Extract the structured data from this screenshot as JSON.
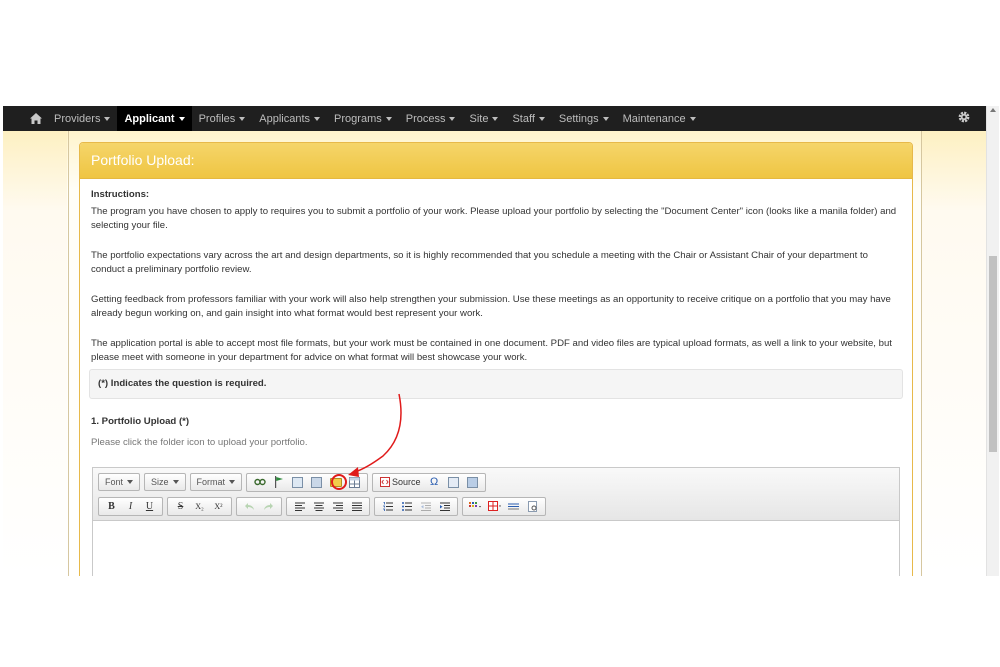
{
  "nav": {
    "items": [
      {
        "label": "Providers",
        "active": false
      },
      {
        "label": "Applicant",
        "active": true
      },
      {
        "label": "Profiles",
        "active": false
      },
      {
        "label": "Applicants",
        "active": false
      },
      {
        "label": "Programs",
        "active": false
      },
      {
        "label": "Process",
        "active": false
      },
      {
        "label": "Site",
        "active": false
      },
      {
        "label": "Staff",
        "active": false
      },
      {
        "label": "Settings",
        "active": false
      },
      {
        "label": "Maintenance",
        "active": false
      }
    ],
    "home_icon": "home-icon",
    "settings_icon": "gear-icon"
  },
  "panel": {
    "title": "Portfolio Upload:",
    "instructions_title": "Instructions:",
    "paragraphs": [
      "The program you have chosen to apply to requires you to submit a portfolio of your work. Please upload your portfolio by selecting the \"Document Center\" icon (looks like a manila folder) and selecting your file.",
      "The portfolio expectations vary across the art and design departments, so it is highly recommended that you schedule a meeting with the Chair or Assistant Chair of your department to conduct a preliminary portfolio review.",
      "Getting feedback from professors familiar with your work will also help strengthen your submission. Use these meetings as an opportunity to receive critique on a portfolio that you may have already begun working on, and gain insight into what format would best represent your work.",
      "The application portal is able to accept most file formats, but your work must be contained in one document. PDF and video files are typical upload formats, as well a link to your website, but please meet with someone in your department for advice on what format will best showcase your work."
    ],
    "required_note": "(*) Indicates the question is required.",
    "question_title": "1. Portfolio Upload  (*)",
    "question_help": "Please click the folder icon to upload your portfolio."
  },
  "editor": {
    "combos": [
      "Font",
      "Size",
      "Format"
    ],
    "source_label": "Source",
    "row2": {
      "bold": "B",
      "italic": "I",
      "underline": "U",
      "strike": "S",
      "subscript": "X₂",
      "superscript": "X²"
    }
  },
  "colors": {
    "heading": "#efc542",
    "annotation": "#e01b1b",
    "navbar": "#1f1f1f"
  }
}
